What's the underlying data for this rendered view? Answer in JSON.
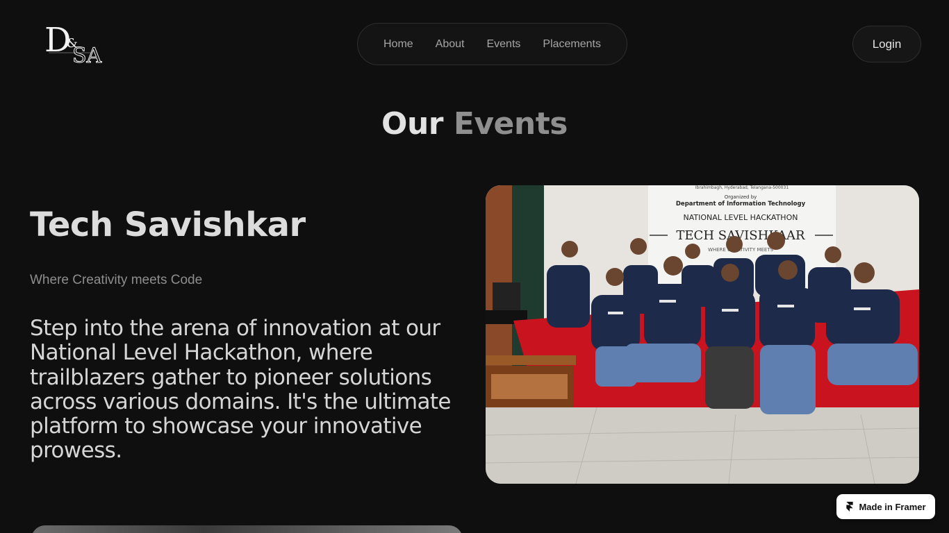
{
  "logo": {
    "monogram_main": "D",
    "monogram_amp": "&",
    "monogram_end": "SA",
    "icon": "dsa-logo"
  },
  "nav": {
    "items": [
      {
        "label": "Home"
      },
      {
        "label": "About"
      },
      {
        "label": "Events"
      },
      {
        "label": "Placements"
      }
    ]
  },
  "header": {
    "login_label": "Login"
  },
  "section": {
    "title_part1": "Our",
    "title_part2": "Events"
  },
  "event": {
    "title": "Tech Savishkar",
    "tagline": "Where Creativity meets Code",
    "description": "Step into the arena of innovation at our National Level Hackathon, where trailblazers gather to pioneer solutions across various domains. It's the ultimate platform to  showcase your innovative prowess.",
    "photo": {
      "banner_line1": "Ibrahimbagh, Hyderabad, Telangana-500031",
      "banner_line2": "Organized by",
      "banner_line3": "Department of Information Technology",
      "banner_line4": "NATIONAL LEVEL HACKATHON",
      "banner_line5": "TECH SAVISHKAAR",
      "banner_line6": "WHERE CREATIVITY MEETS"
    }
  },
  "badge": {
    "label": "Made in Framer",
    "icon": "framer-icon"
  },
  "colors": {
    "background": "#0f0f0f",
    "muted_text": "#8e8e8e",
    "accent_white": "#ffffff"
  }
}
